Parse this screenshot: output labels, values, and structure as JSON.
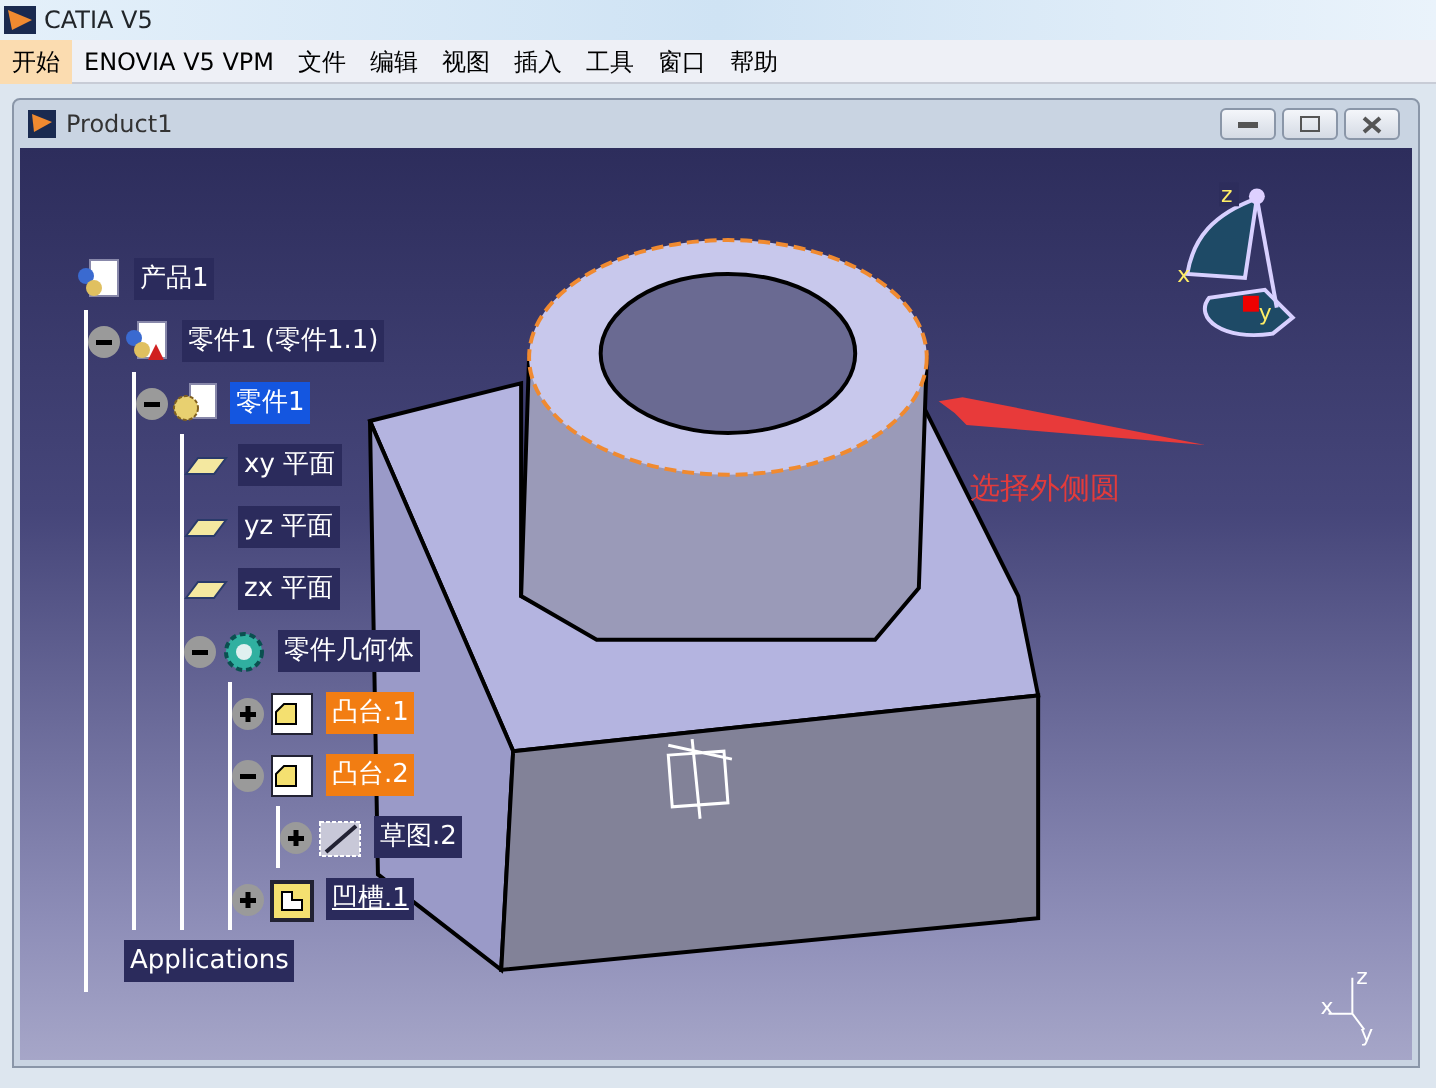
{
  "app_title": "CATIA V5",
  "menu": [
    {
      "label": "开始",
      "selected": true
    },
    {
      "label": "ENOVIA V5 VPM",
      "selected": false
    },
    {
      "label": "文件",
      "selected": false
    },
    {
      "label": "编辑",
      "selected": false
    },
    {
      "label": "视图",
      "selected": false
    },
    {
      "label": "插入",
      "selected": false
    },
    {
      "label": "工具",
      "selected": false
    },
    {
      "label": "窗口",
      "selected": false
    },
    {
      "label": "帮助",
      "selected": false
    }
  ],
  "window": {
    "title": "Product1"
  },
  "tree": [
    {
      "label": "产品1",
      "kind": "product",
      "selected": false,
      "highlighted": false,
      "children": [
        {
          "label": "零件1 (零件1.1)",
          "kind": "instance",
          "expanded": true,
          "selected": false,
          "highlighted": false,
          "children": [
            {
              "label": "零件1",
              "kind": "part",
              "expanded": true,
              "selected": true,
              "highlighted": false,
              "children": [
                {
                  "label": "xy 平面",
                  "kind": "plane",
                  "selected": false,
                  "highlighted": false
                },
                {
                  "label": "yz 平面",
                  "kind": "plane",
                  "selected": false,
                  "highlighted": false
                },
                {
                  "label": "zx 平面",
                  "kind": "plane",
                  "selected": false,
                  "highlighted": false
                },
                {
                  "label": "零件几何体",
                  "kind": "body",
                  "expanded": true,
                  "selected": false,
                  "highlighted": false,
                  "children": [
                    {
                      "label": "凸台.1",
                      "kind": "pad",
                      "expanded": false,
                      "selected": false,
                      "highlighted": true
                    },
                    {
                      "label": "凸台.2",
                      "kind": "pad",
                      "expanded": true,
                      "selected": false,
                      "highlighted": true,
                      "children": [
                        {
                          "label": "草图.2",
                          "kind": "sketch",
                          "expanded": false,
                          "selected": false,
                          "highlighted": false
                        }
                      ]
                    },
                    {
                      "label": "凹槽.1",
                      "kind": "pocket",
                      "expanded": false,
                      "selected": false,
                      "highlighted": false
                    }
                  ]
                }
              ]
            }
          ]
        },
        {
          "label": "Applications",
          "kind": "text",
          "selected": false,
          "highlighted": false
        }
      ]
    }
  ],
  "compass": {
    "x_label": "x",
    "y_label": "y",
    "z_label": "z"
  },
  "annotation": {
    "text": "选择外侧圆"
  },
  "axis_triad": {
    "x_label": "x",
    "y_label": "y",
    "z_label": "z"
  }
}
